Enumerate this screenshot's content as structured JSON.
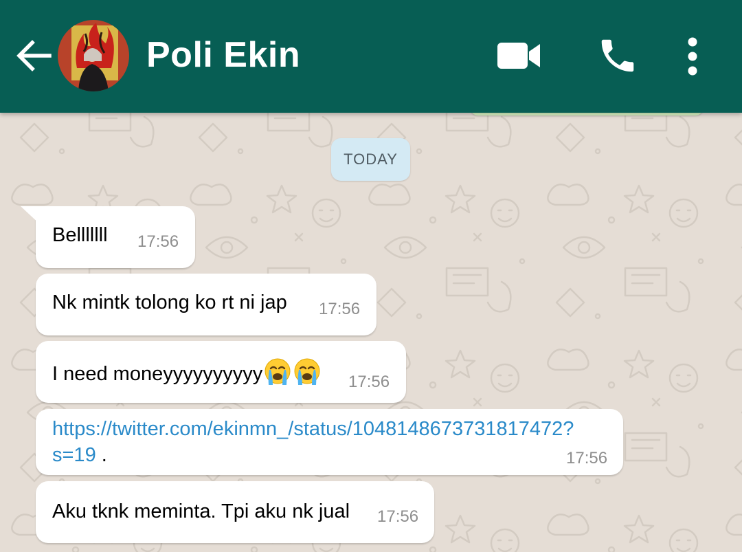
{
  "header": {
    "contact_name": "Poli Ekin",
    "back_icon": "arrow-left-icon",
    "video_icon": "video-camera-icon",
    "call_icon": "phone-icon",
    "menu_icon": "more-vertical-icon",
    "background_color": "#075e54"
  },
  "date_divider": "TODAY",
  "messages": [
    {
      "text": "Belllllll",
      "time": "17:56"
    },
    {
      "text": "Nk mintk tolong ko rt ni jap",
      "time": "17:56"
    },
    {
      "text": "I need moneyyyyyyyyyy",
      "emoji": [
        "crying-face",
        "crying-face"
      ],
      "time": "17:56"
    },
    {
      "link_line1": "https://twitter.com/ekinmn_/status/1048148673731817472?",
      "link_line2": "s=19",
      "suffix": " .",
      "time": "17:56"
    },
    {
      "text": "Aku tknk meminta. Tpi aku nk jual",
      "time": "17:56"
    }
  ],
  "colors": {
    "wallpaper": "#e5ddd5",
    "incoming_bubble": "#ffffff",
    "outgoing_bubble": "#dcf8c6",
    "link": "#2a8ac9",
    "date_chip": "#d4eaf4"
  }
}
